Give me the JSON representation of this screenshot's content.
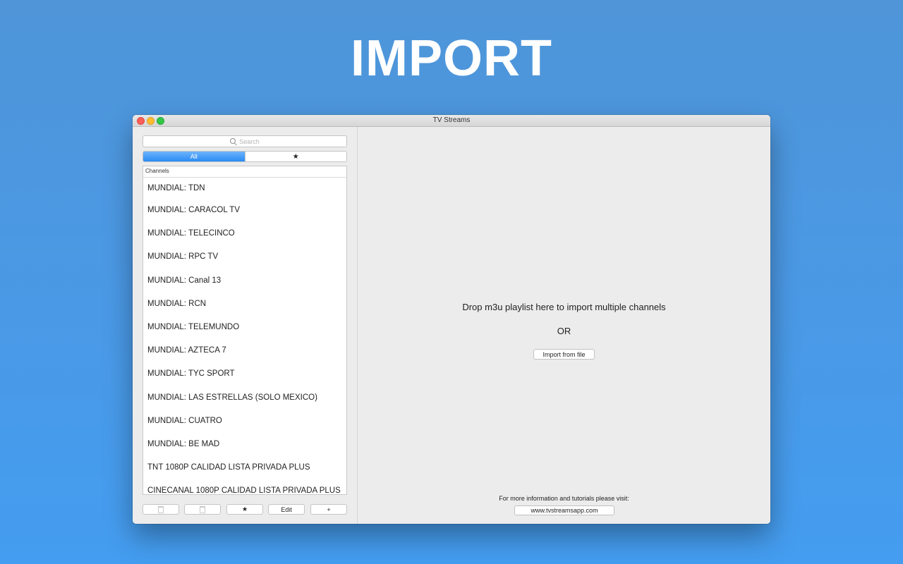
{
  "hero": {
    "title": "IMPORT"
  },
  "window": {
    "title": "TV Streams"
  },
  "sidebar": {
    "search": {
      "placeholder": "Search"
    },
    "segments": {
      "all": "All",
      "favorites": "★"
    },
    "list": {
      "header": "Channels",
      "rows": [
        "MUNDIAL: TDN",
        "MUNDIAL: CARACOL TV",
        "MUNDIAL: TELECINCO",
        "MUNDIAL: RPC TV",
        "MUNDIAL: Canal 13",
        "MUNDIAL: RCN",
        "MUNDIAL: TELEMUNDO",
        "MUNDIAL: AZTECA 7",
        "MUNDIAL: TYC SPORT",
        "MUNDIAL: LAS ESTRELLAS (SOLO MEXICO)",
        "MUNDIAL: CUATRO",
        "MUNDIAL: BE MAD",
        "TNT 1080P CALIDAD LISTA PRIVADA PLUS",
        "CINECANAL 1080P CALIDAD LISTA PRIVADA PLUS"
      ]
    },
    "toolbar": {
      "favorite_label": "★",
      "edit_label": "Edit",
      "add_label": "+",
      "icons": [
        "trash-icon",
        "trash-icon"
      ]
    }
  },
  "main": {
    "drop_text": "Drop m3u playlist here to import multiple channels",
    "or_text": "OR",
    "import_button": "Import from file",
    "info_text": "For more information and tutorials please visit:",
    "website_button": "www.tvstreamsapp.com"
  },
  "colors": {
    "background_top": "#4f95d8",
    "background_bottom": "#449df0",
    "segment_selected": "#2a8bf5",
    "close": "#fc5f57",
    "minimize": "#fdbc2e",
    "maximize": "#33c748"
  }
}
